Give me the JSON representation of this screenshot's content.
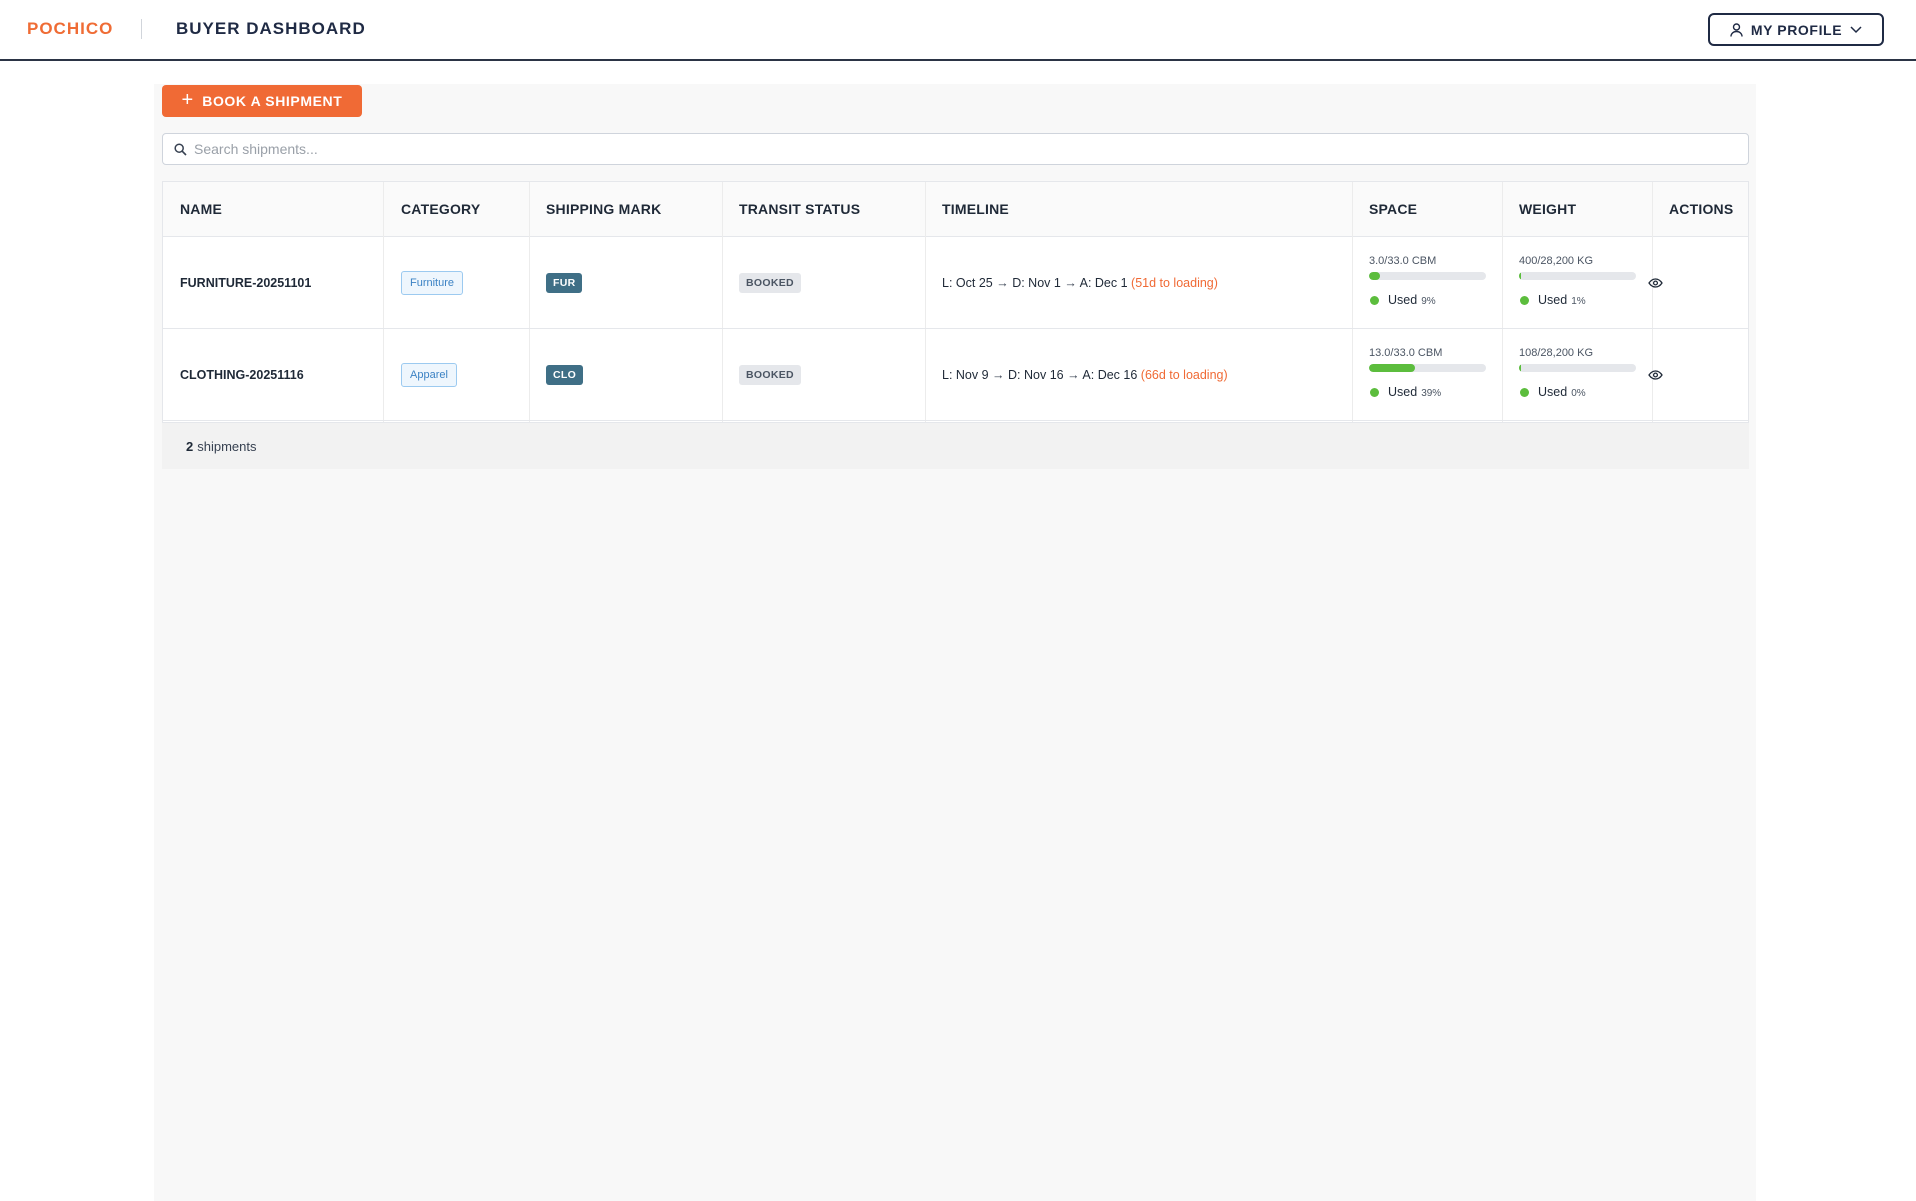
{
  "header": {
    "brand": "POCHICO",
    "title": "BUYER DASHBOARD",
    "profile_label": "MY PROFILE"
  },
  "actions": {
    "book_label": "BOOK A SHIPMENT"
  },
  "search": {
    "placeholder": "Search shipments...",
    "value": ""
  },
  "table": {
    "columns": [
      "NAME",
      "CATEGORY",
      "SHIPPING MARK",
      "TRANSIT STATUS",
      "TIMELINE",
      "SPACE",
      "WEIGHT",
      "ACTIONS"
    ],
    "rows": [
      {
        "name": "FURNITURE-20251101",
        "category": "Furniture",
        "mark": "FUR",
        "status": "BOOKED",
        "timeline_load": "L: Oct 25",
        "timeline_depart": "D: Nov 1",
        "timeline_arrive": "A: Dec 1",
        "timeline_countdown": "(51d to loading)",
        "space_text": "3.0/33.0 CBM",
        "space_used_fraction": 0.09,
        "space_used_label": "Used",
        "space_pct": "9%",
        "weight_text": "400/28,200 KG",
        "weight_used_fraction": 0.014,
        "weight_used_label": "Used",
        "weight_pct": "1%"
      },
      {
        "name": "CLOTHING-20251116",
        "category": "Apparel",
        "mark": "CLO",
        "status": "BOOKED",
        "timeline_load": "L: Nov 9",
        "timeline_depart": "D: Nov 16",
        "timeline_arrive": "A: Dec 16",
        "timeline_countdown": "(66d to loading)",
        "space_text": "13.0/33.0 CBM",
        "space_used_fraction": 0.39,
        "space_used_label": "Used",
        "space_pct": "39%",
        "weight_text": "108/28,200 KG",
        "weight_used_fraction": 0.004,
        "weight_used_label": "Used",
        "weight_pct": "0%"
      }
    ]
  },
  "footer": {
    "count": "2",
    "count_label": "shipments"
  },
  "colors": {
    "accent": "#f06a35",
    "nav_dark": "#1f2a44",
    "progress_green": "#5cbd3d",
    "mark_badge": "#3f6f86"
  },
  "icons": {
    "profile": "user-icon",
    "dropdown": "chevron-down-icon",
    "book": "plus-icon",
    "search": "search-icon",
    "view": "eye-icon"
  }
}
